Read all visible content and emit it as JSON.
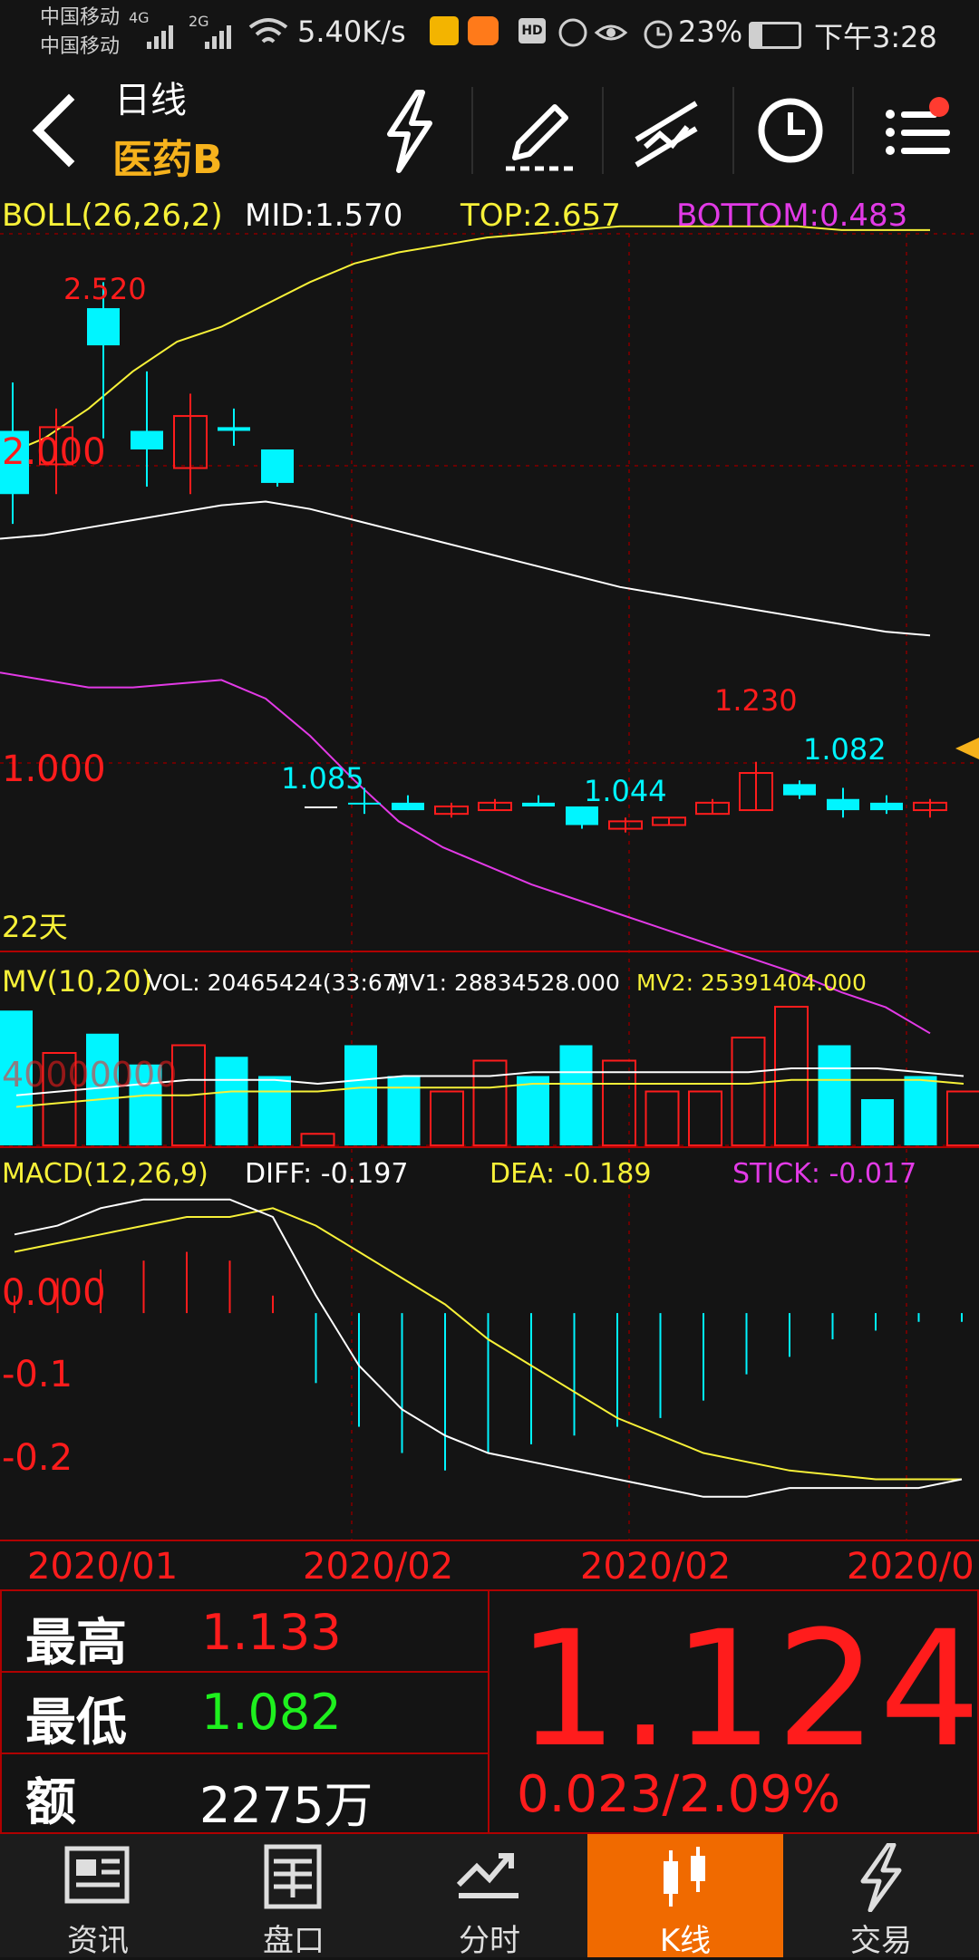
{
  "status_bar": {
    "carrier1": "中国移动",
    "carrier2": "中国移动",
    "net1": "4G",
    "net2": "2G",
    "speed": "5.40K/s",
    "battery": "23%",
    "time": "下午3:28",
    "hd": "HD"
  },
  "header": {
    "title": "日线",
    "subtitle": "医药B",
    "icons": [
      "back-icon",
      "lightning-icon",
      "pencil-icon",
      "draw-lines-icon",
      "clock-icon",
      "menu-icon"
    ],
    "notify_color": "#ff3b30"
  },
  "boll": {
    "label": "BOLL(26,26,2)",
    "mid": "MID:1.570",
    "top": "TOP:2.657",
    "bottom": "BOTTOM:0.483",
    "price_labels": [
      "2.000",
      "1.000"
    ],
    "marks": [
      "2.520",
      "1.085",
      "1.044",
      "1.230",
      "1.082"
    ],
    "day_label": "22天",
    "mid_color": "#ffffff",
    "top_color": "#f7f138",
    "bottom_color": "#e23ae6"
  },
  "vol": {
    "label": "MV(10,20)",
    "vol": "VOL: 20465424(33:67)",
    "mv1": "MV1: 28834528.000",
    "mv2": "MV2: 25391404.000",
    "axis_label": "40000000"
  },
  "macd": {
    "label": "MACD(12,26,9)",
    "diff": "DIFF: -0.197",
    "dea": "DEA: -0.189",
    "stick": "STICK: -0.017",
    "axis": [
      "0.000",
      "-0.1",
      "-0.2"
    ]
  },
  "dates": [
    "2020/01",
    "2020/02",
    "2020/02",
    "2020/0"
  ],
  "info": {
    "high_label": "最高",
    "high": "1.133",
    "low_label": "最低",
    "low": "1.082",
    "amount_label": "额",
    "amount": "2275万",
    "price": "1.124",
    "change": "0.023/2.09%"
  },
  "nav": [
    {
      "label": "资讯",
      "icon": "news-icon"
    },
    {
      "label": "盘口",
      "icon": "order-book-icon"
    },
    {
      "label": "分时",
      "icon": "intraday-icon"
    },
    {
      "label": "K线",
      "icon": "candlestick-icon",
      "active": true
    },
    {
      "label": "交易",
      "icon": "trade-icon"
    }
  ],
  "colors": {
    "up": "#ff1c1c",
    "down": "#00f5ff",
    "accent": "#f06a00",
    "yellow": "#f7f138",
    "magenta": "#e23ae6"
  },
  "chart_data": {
    "type": "candlestick",
    "x": [
      "2020/01",
      "2020/02",
      "2020/02",
      "2020/0"
    ],
    "price_ylim": [
      0.72,
      2.65
    ],
    "price_ticks": [
      2.0,
      1.0
    ],
    "candles": [
      {
        "o": 1.95,
        "h": 2.25,
        "l": 1.87,
        "c": 2.12,
        "dir": "down"
      },
      {
        "o": 2.13,
        "h": 2.18,
        "l": 1.95,
        "c": 2.03,
        "dir": "up"
      },
      {
        "o": 2.45,
        "h": 2.52,
        "l": 2.1,
        "c": 2.35,
        "dir": "down"
      },
      {
        "o": 2.12,
        "h": 2.28,
        "l": 1.97,
        "c": 2.07,
        "dir": "down"
      },
      {
        "o": 2.02,
        "h": 2.22,
        "l": 1.95,
        "c": 2.16,
        "dir": "up"
      },
      {
        "o": 2.13,
        "h": 2.18,
        "l": 2.08,
        "c": 2.12,
        "dir": "down"
      },
      {
        "o": 2.07,
        "h": 2.07,
        "l": 1.97,
        "c": 1.98,
        "dir": "down"
      },
      {
        "o": 1.11,
        "h": 1.11,
        "l": 1.11,
        "c": 1.11,
        "dir": "flat"
      },
      {
        "o": 1.12,
        "h": 1.16,
        "l": 1.09,
        "c": 1.12,
        "dir": "down"
      },
      {
        "o": 1.12,
        "h": 1.14,
        "l": 1.1,
        "c": 1.1,
        "dir": "down"
      },
      {
        "o": 1.09,
        "h": 1.12,
        "l": 1.08,
        "c": 1.11,
        "dir": "up"
      },
      {
        "o": 1.1,
        "h": 1.13,
        "l": 1.1,
        "c": 1.12,
        "dir": "up"
      },
      {
        "o": 1.12,
        "h": 1.14,
        "l": 1.11,
        "c": 1.11,
        "dir": "down"
      },
      {
        "o": 1.11,
        "h": 1.11,
        "l": 1.05,
        "c": 1.06,
        "dir": "down"
      },
      {
        "o": 1.05,
        "h": 1.08,
        "l": 1.04,
        "c": 1.07,
        "dir": "up"
      },
      {
        "o": 1.06,
        "h": 1.08,
        "l": 1.06,
        "c": 1.08,
        "dir": "up"
      },
      {
        "o": 1.09,
        "h": 1.13,
        "l": 1.09,
        "c": 1.12,
        "dir": "up"
      },
      {
        "o": 1.1,
        "h": 1.23,
        "l": 1.1,
        "c": 1.2,
        "dir": "up"
      },
      {
        "o": 1.17,
        "h": 1.18,
        "l": 1.13,
        "c": 1.14,
        "dir": "down"
      },
      {
        "o": 1.13,
        "h": 1.16,
        "l": 1.08,
        "c": 1.1,
        "dir": "down"
      },
      {
        "o": 1.1,
        "h": 1.14,
        "l": 1.09,
        "c": 1.12,
        "dir": "down"
      },
      {
        "o": 1.1,
        "h": 1.13,
        "l": 1.08,
        "c": 1.12,
        "dir": "up"
      }
    ],
    "boll_mid": [
      1.83,
      1.84,
      1.86,
      1.88,
      1.9,
      1.92,
      1.93,
      1.91,
      1.88,
      1.85,
      1.82,
      1.79,
      1.76,
      1.73,
      1.7,
      1.68,
      1.66,
      1.64,
      1.62,
      1.6,
      1.58,
      1.57
    ],
    "boll_top": [
      2.05,
      2.1,
      2.18,
      2.28,
      2.36,
      2.4,
      2.46,
      2.52,
      2.57,
      2.6,
      2.62,
      2.64,
      2.65,
      2.66,
      2.67,
      2.67,
      2.67,
      2.67,
      2.67,
      2.66,
      2.66,
      2.66
    ],
    "boll_bottom": [
      1.47,
      1.45,
      1.43,
      1.43,
      1.44,
      1.45,
      1.4,
      1.3,
      1.18,
      1.07,
      1.0,
      0.95,
      0.9,
      0.86,
      0.82,
      0.78,
      0.74,
      0.7,
      0.66,
      0.61,
      0.57,
      0.5
    ],
    "volume": [
      35,
      24,
      29,
      21,
      26,
      23,
      18,
      3,
      26,
      18,
      14,
      22,
      18,
      26,
      22,
      14,
      14,
      28,
      36,
      26,
      12,
      18,
      14
    ],
    "volume_dir": [
      "down",
      "up",
      "down",
      "down",
      "up",
      "down",
      "down",
      "up",
      "down",
      "down",
      "up",
      "up",
      "down",
      "down",
      "up",
      "up",
      "up",
      "up",
      "up",
      "down",
      "down",
      "down",
      "up"
    ],
    "mv1": [
      13,
      14,
      15,
      16,
      17,
      17,
      17,
      16,
      17,
      18,
      18,
      18,
      19,
      19,
      19,
      19,
      19,
      19,
      20,
      20,
      20,
      19,
      18
    ],
    "mv2": [
      10,
      11,
      12,
      13,
      13,
      14,
      14,
      14,
      15,
      15,
      15,
      15,
      16,
      16,
      16,
      16,
      16,
      16,
      17,
      17,
      17,
      17,
      16
    ],
    "macd_ylim": [
      -0.26,
      0.14
    ],
    "macd_diff": [
      0.09,
      0.1,
      0.12,
      0.13,
      0.13,
      0.13,
      0.11,
      0.02,
      -0.06,
      -0.11,
      -0.14,
      -0.16,
      -0.17,
      -0.18,
      -0.19,
      -0.2,
      -0.21,
      -0.21,
      -0.2,
      -0.2,
      -0.2,
      -0.2,
      -0.19
    ],
    "macd_dea": [
      0.07,
      0.08,
      0.09,
      0.1,
      0.11,
      0.11,
      0.12,
      0.1,
      0.07,
      0.04,
      0.01,
      -0.03,
      -0.06,
      -0.09,
      -0.12,
      -0.14,
      -0.16,
      -0.17,
      -0.18,
      -0.185,
      -0.19,
      -0.19,
      -0.19
    ],
    "macd_stick": [
      0.02,
      0.04,
      0.05,
      0.06,
      0.07,
      0.06,
      0.02,
      -0.08,
      -0.13,
      -0.16,
      -0.18,
      -0.16,
      -0.15,
      -0.14,
      -0.13,
      -0.12,
      -0.1,
      -0.07,
      -0.05,
      -0.03,
      -0.02,
      -0.01,
      -0.01
    ]
  }
}
